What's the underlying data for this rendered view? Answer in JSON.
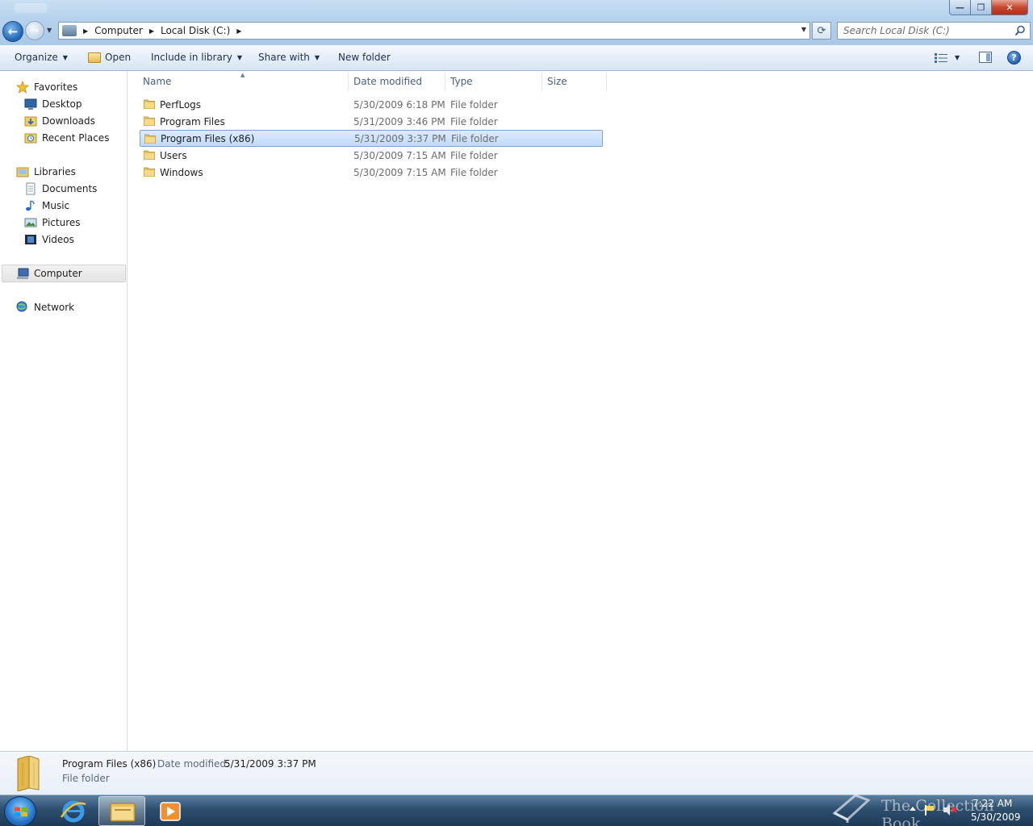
{
  "window": {
    "minimize_glyph": "—",
    "restore_glyph": "❐",
    "close_glyph": "✕"
  },
  "nav": {
    "back_glyph": "←",
    "forward_glyph": "→",
    "history_glyph": "▼"
  },
  "address": {
    "crumbs": [
      "Computer",
      "Local Disk (C:)"
    ],
    "separator_glyph": "▶",
    "dropdown_glyph": "▼",
    "refresh_glyph": "⟳"
  },
  "search": {
    "placeholder": "Search Local Disk (C:)"
  },
  "toolbar": {
    "organize": "Organize",
    "open": "Open",
    "include": "Include in library",
    "share": "Share with",
    "new_folder": "New folder",
    "caret": "▼",
    "help_glyph": "?"
  },
  "sidebar": {
    "favorites": {
      "label": "Favorites",
      "items": [
        "Desktop",
        "Downloads",
        "Recent Places"
      ]
    },
    "libraries": {
      "label": "Libraries",
      "items": [
        "Documents",
        "Music",
        "Pictures",
        "Videos"
      ]
    },
    "computer": "Computer",
    "network": "Network"
  },
  "columns": {
    "name": "Name",
    "date": "Date modified",
    "type": "Type",
    "size": "Size",
    "sort_glyph": "▲"
  },
  "files": [
    {
      "name": "PerfLogs",
      "date": "5/30/2009 6:18 PM",
      "type": "File folder"
    },
    {
      "name": "Program Files",
      "date": "5/31/2009 3:46 PM",
      "type": "File folder"
    },
    {
      "name": "Program Files (x86)",
      "date": "5/31/2009 3:37 PM",
      "type": "File folder"
    },
    {
      "name": "Users",
      "date": "5/30/2009 7:15 AM",
      "type": "File folder"
    },
    {
      "name": "Windows",
      "date": "5/30/2009 7:15 AM",
      "type": "File folder"
    }
  ],
  "details": {
    "name": "Program Files (x86)",
    "date_label": "Date modified:",
    "date_value": "5/31/2009 3:37 PM",
    "type": "File folder"
  },
  "taskbar": {
    "time": "7:22 AM",
    "date": "5/30/2009",
    "watermark": "The Collection Book"
  },
  "colors": {
    "selection": "#c1dbfc",
    "selection_border": "#7da2ce",
    "taskbar": "#2d4e6e"
  }
}
